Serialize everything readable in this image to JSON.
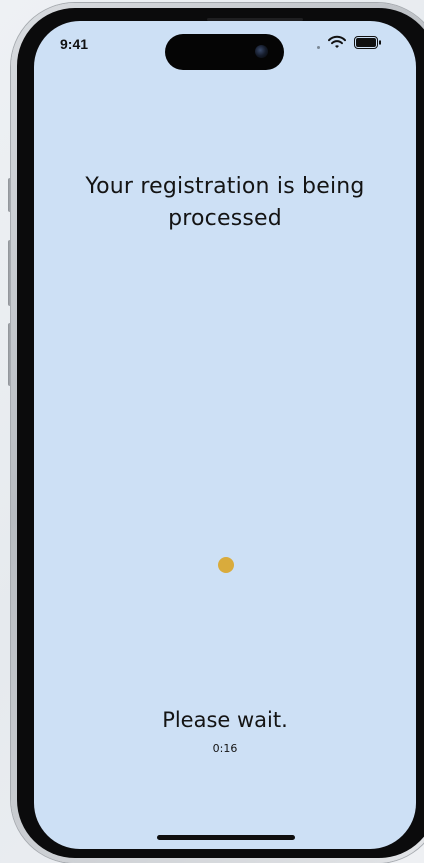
{
  "status_bar": {
    "time": "9:41",
    "wifi_icon": "wifi-icon",
    "battery_icon": "battery-icon"
  },
  "main": {
    "title": "Your registration is being processed",
    "loader_color": "#d9ab3c",
    "wait_message": "Please wait.",
    "timer": "0:16"
  },
  "colors": {
    "screen_background": "#cde0f5",
    "text": "#141414"
  }
}
